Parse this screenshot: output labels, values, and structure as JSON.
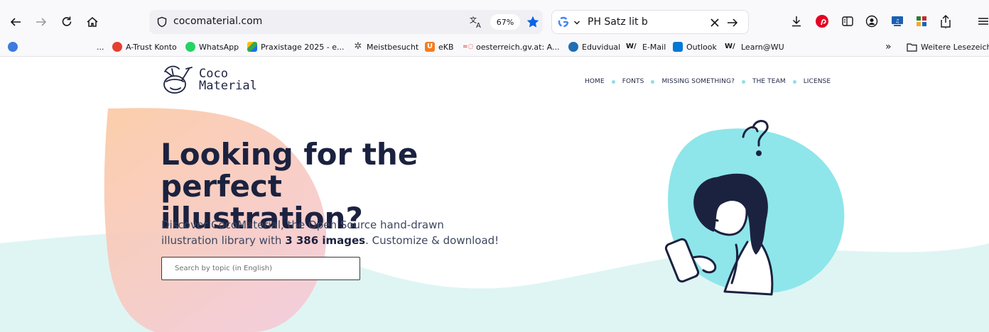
{
  "browser": {
    "url": "cocomaterial.com",
    "zoom": "67%",
    "search_query": "PH Satz lit b",
    "icons": [
      "back-icon",
      "forward-icon",
      "reload-icon",
      "home-icon",
      "shield-icon",
      "translate-icon",
      "star-icon",
      "google-icon",
      "download-icon",
      "pinterest-icon",
      "reader-icon",
      "account-icon",
      "extension-icon",
      "qr-icon",
      "share-icon",
      "menu-icon"
    ]
  },
  "bookmarks": {
    "items": [
      {
        "label": "A-Trust Konto",
        "color": "#e5402f"
      },
      {
        "label": "WhatsApp",
        "color": "#25d366"
      },
      {
        "label": "Praxistage 2025 - e...",
        "color": "#1a73e8"
      },
      {
        "label": "Meistbesucht",
        "color": "#555555"
      },
      {
        "label": "eKB",
        "color": "#f57c1f"
      },
      {
        "label": "oesterreich.gv.at: A...",
        "color": "#d62828"
      },
      {
        "label": "Eduvidual",
        "color": "#1f6fb2"
      },
      {
        "label": "E-Mail",
        "color": "#222222"
      },
      {
        "label": "Outlook",
        "color": "#0078d4"
      },
      {
        "label": "Learn@WU",
        "color": "#222222"
      }
    ],
    "ellipsis": "...",
    "overflow": "»",
    "other_folder": "Weitere Lesezeiche"
  },
  "site": {
    "logo": {
      "line1": "Coco",
      "line2": "Material"
    },
    "nav": [
      "HOME",
      "FONTS",
      "MISSING SOMETHING?",
      "THE TEAM",
      "LICENSE"
    ],
    "hero": {
      "title_line1": "Looking for the perfect",
      "title_line2": "illustration?",
      "desc_before": "Discover CocoMaterial, the Open Source hand-drawn illustration library with ",
      "desc_count": "3 386 images",
      "desc_after": ". Customize & download!"
    },
    "search_placeholder": "Search by topic (in English)"
  },
  "colors": {
    "accent_blob": "#f9c4a6",
    "wave": "#dff5f3",
    "illustration_blob": "#8ee6ea",
    "navy": "#1b2240"
  }
}
